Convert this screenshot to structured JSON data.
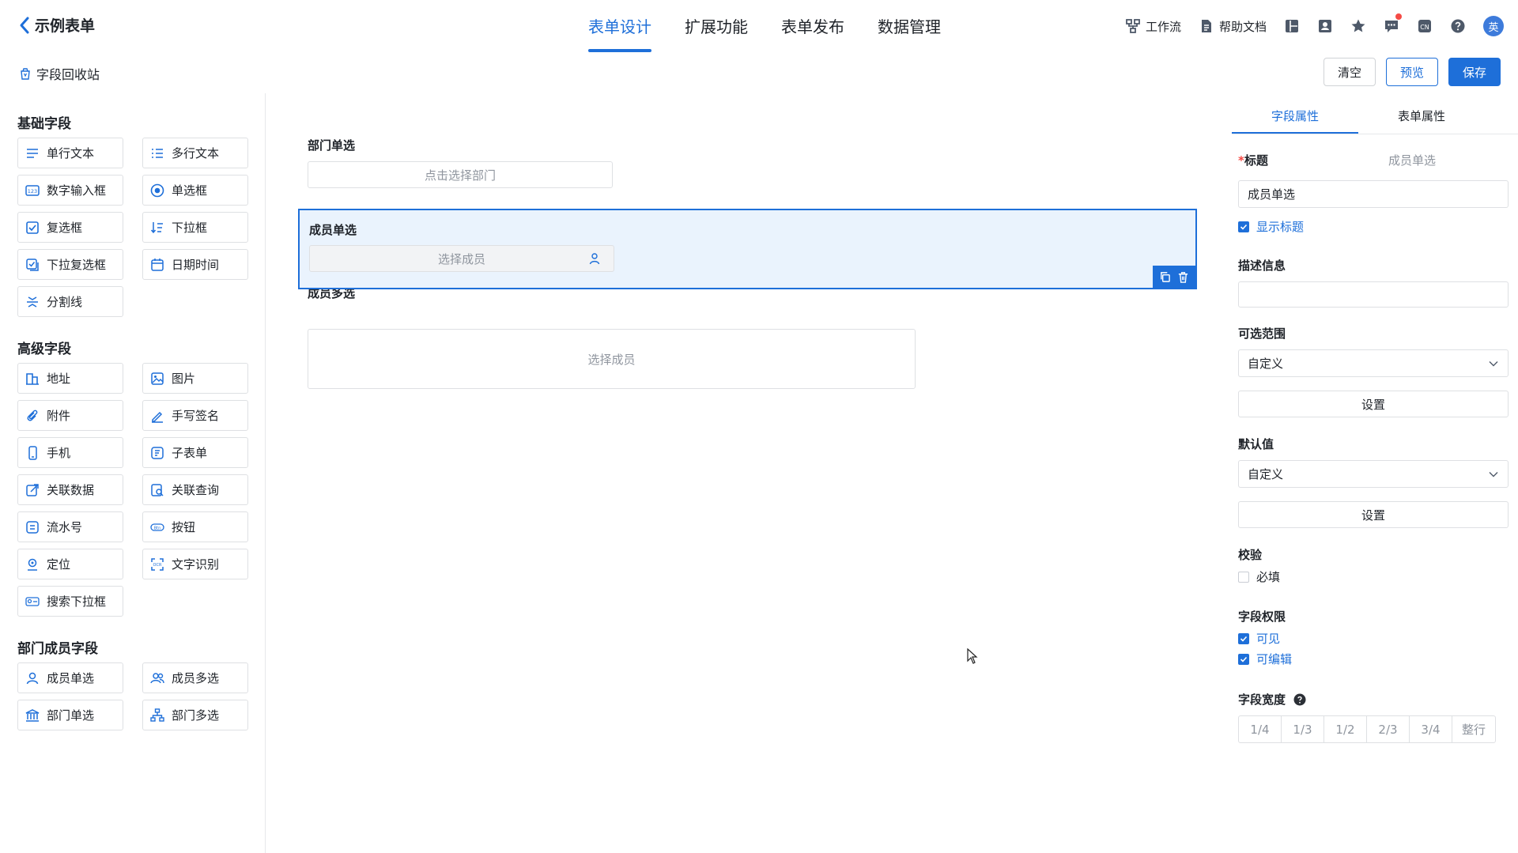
{
  "header": {
    "back_title": "示例表单",
    "nav": [
      "表单设计",
      "扩展功能",
      "表单发布",
      "数据管理"
    ],
    "active_nav": "表单设计",
    "tools": {
      "workflow": "工作流",
      "help_docs": "帮助文档",
      "lang_badge": "CN",
      "avatar_text": "英"
    }
  },
  "toolbar": {
    "recycle": "字段回收站",
    "clear": "清空",
    "preview": "预览",
    "save": "保存"
  },
  "left": {
    "basic_title": "基础字段",
    "basic": [
      {
        "label": "单行文本",
        "icon": "single-line-text-icon"
      },
      {
        "label": "多行文本",
        "icon": "multi-line-text-icon"
      },
      {
        "label": "数字输入框",
        "icon": "number-input-icon"
      },
      {
        "label": "单选框",
        "icon": "radio-icon"
      },
      {
        "label": "复选框",
        "icon": "checkbox-icon"
      },
      {
        "label": "下拉框",
        "icon": "dropdown-icon"
      },
      {
        "label": "下拉复选框",
        "icon": "dropdown-checkbox-icon"
      },
      {
        "label": "日期时间",
        "icon": "calendar-icon"
      },
      {
        "label": "分割线",
        "icon": "divider-icon"
      }
    ],
    "advanced_title": "高级字段",
    "advanced": [
      {
        "label": "地址",
        "icon": "address-icon"
      },
      {
        "label": "图片",
        "icon": "image-icon"
      },
      {
        "label": "附件",
        "icon": "attachment-icon"
      },
      {
        "label": "手写签名",
        "icon": "signature-icon"
      },
      {
        "label": "手机",
        "icon": "phone-icon"
      },
      {
        "label": "子表单",
        "icon": "subform-icon"
      },
      {
        "label": "关联数据",
        "icon": "linked-data-icon"
      },
      {
        "label": "关联查询",
        "icon": "linked-query-icon"
      },
      {
        "label": "流水号",
        "icon": "serial-number-icon"
      },
      {
        "label": "按钮",
        "icon": "button-icon"
      },
      {
        "label": "定位",
        "icon": "location-icon"
      },
      {
        "label": "文字识别",
        "icon": "ocr-icon"
      },
      {
        "label": "搜索下拉框",
        "icon": "search-dropdown-icon"
      }
    ],
    "dept_title": "部门成员字段",
    "dept": [
      {
        "label": "成员单选",
        "icon": "member-icon"
      },
      {
        "label": "成员多选",
        "icon": "members-icon"
      },
      {
        "label": "部门单选",
        "icon": "department-icon"
      },
      {
        "label": "部门多选",
        "icon": "department-tree-icon"
      }
    ]
  },
  "canvas": {
    "dept_single": {
      "label": "部门单选",
      "placeholder": "点击选择部门"
    },
    "member_single": {
      "label": "成员单选",
      "placeholder": "选择成员"
    },
    "member_multi": {
      "label": "成员多选",
      "placeholder": "选择成员"
    }
  },
  "props": {
    "tabs": [
      "字段属性",
      "表单属性"
    ],
    "title_label": "标题",
    "title_hint": "成员单选",
    "title_value": "成员单选",
    "show_title": "显示标题",
    "desc_label": "描述信息",
    "range_label": "可选范围",
    "range_value": "自定义",
    "range_btn": "设置",
    "default_label": "默认值",
    "default_value": "自定义",
    "default_btn": "设置",
    "validate_label": "校验",
    "required": "必填",
    "perm_label": "字段权限",
    "visible": "可见",
    "editable": "可编辑",
    "width_label": "字段宽度",
    "widths": [
      "1/4",
      "1/3",
      "1/2",
      "2/3",
      "3/4",
      "整行"
    ]
  },
  "colors": {
    "accent": "#1e6fd9",
    "selected_bg": "#eaf3fd"
  }
}
